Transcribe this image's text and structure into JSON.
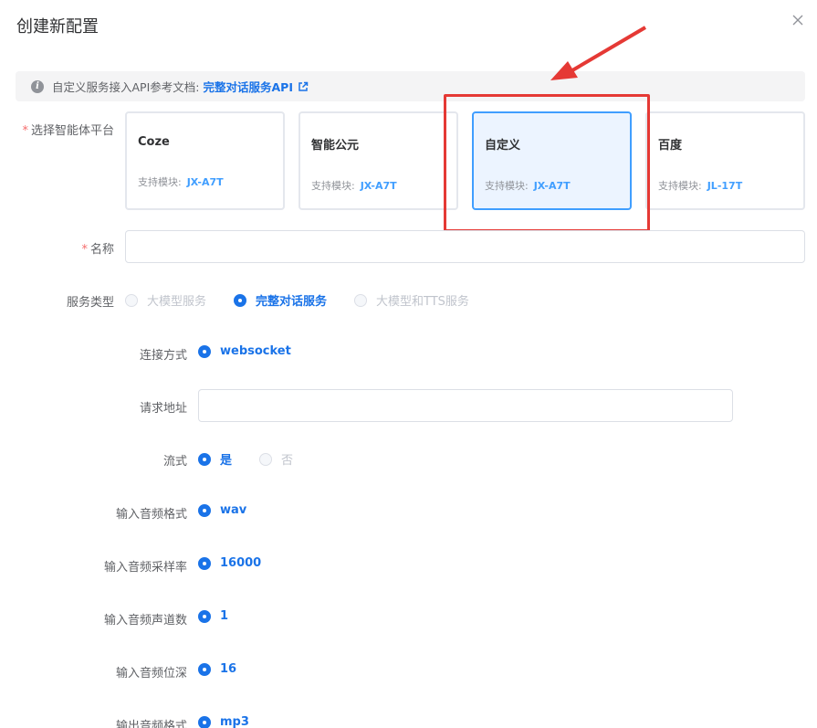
{
  "dialog": {
    "title": "创建新配置"
  },
  "alert": {
    "text": "自定义服务接入API参考文档:",
    "link": "完整对话服务API"
  },
  "platform": {
    "label": "选择智能体平台",
    "cards": [
      {
        "name": "Coze",
        "sub_label": "支持模块:",
        "module": "JX-A7T",
        "selected": false
      },
      {
        "name": "智能公元",
        "sub_label": "支持模块:",
        "module": "JX-A7T",
        "selected": false
      },
      {
        "name": "自定义",
        "sub_label": "支持模块:",
        "module": "JX-A7T",
        "selected": true
      },
      {
        "name": "百度",
        "sub_label": "支持模块:",
        "module": "JL-17T",
        "selected": false
      }
    ]
  },
  "name_field": {
    "label": "名称",
    "value": ""
  },
  "service_type": {
    "label": "服务类型",
    "options": [
      "大模型服务",
      "完整对话服务",
      "大模型和TTS服务"
    ],
    "selected": "完整对话服务"
  },
  "connection": {
    "label": "连接方式",
    "value": "websocket"
  },
  "request_url": {
    "label": "请求地址",
    "value": ""
  },
  "stream": {
    "label": "流式",
    "options": [
      "是",
      "否"
    ],
    "selected": "是"
  },
  "input_format": {
    "label": "输入音频格式",
    "value": "wav"
  },
  "input_rate": {
    "label": "输入音频采样率",
    "value": "16000"
  },
  "input_channels": {
    "label": "输入音频声道数",
    "value": "1"
  },
  "input_depth": {
    "label": "输入音频位深",
    "value": "16"
  },
  "output_format": {
    "label": "输出音频格式",
    "value": "mp3"
  },
  "colors": {
    "accent": "#1a73e8",
    "annotation": "#e53935",
    "selected_card_bg": "#ecf4ff"
  }
}
